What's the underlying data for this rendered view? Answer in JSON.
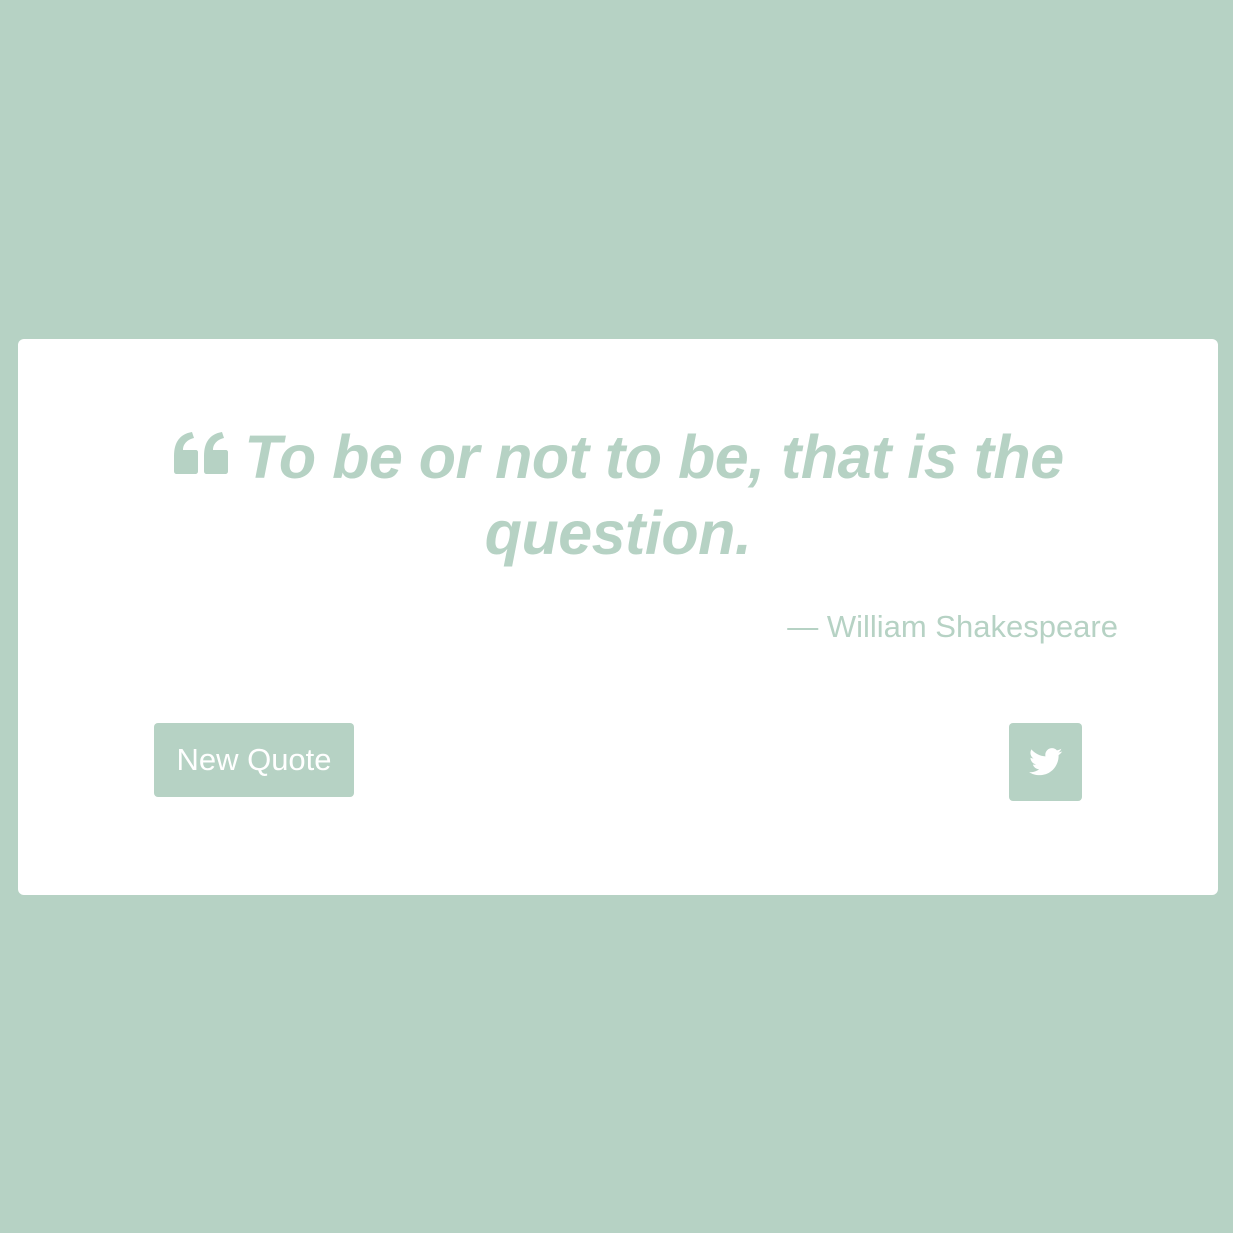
{
  "theme": {
    "accent_color": "#b6d2c4",
    "card_color": "#ffffff",
    "button_text_color": "#ffffff"
  },
  "quote": {
    "icon": "quote-left-icon",
    "text": "To be or not to be, that is the question.",
    "author": "— William Shakespeare"
  },
  "actions": {
    "new_quote_label": "New Quote",
    "tweet_icon": "twitter-icon"
  }
}
